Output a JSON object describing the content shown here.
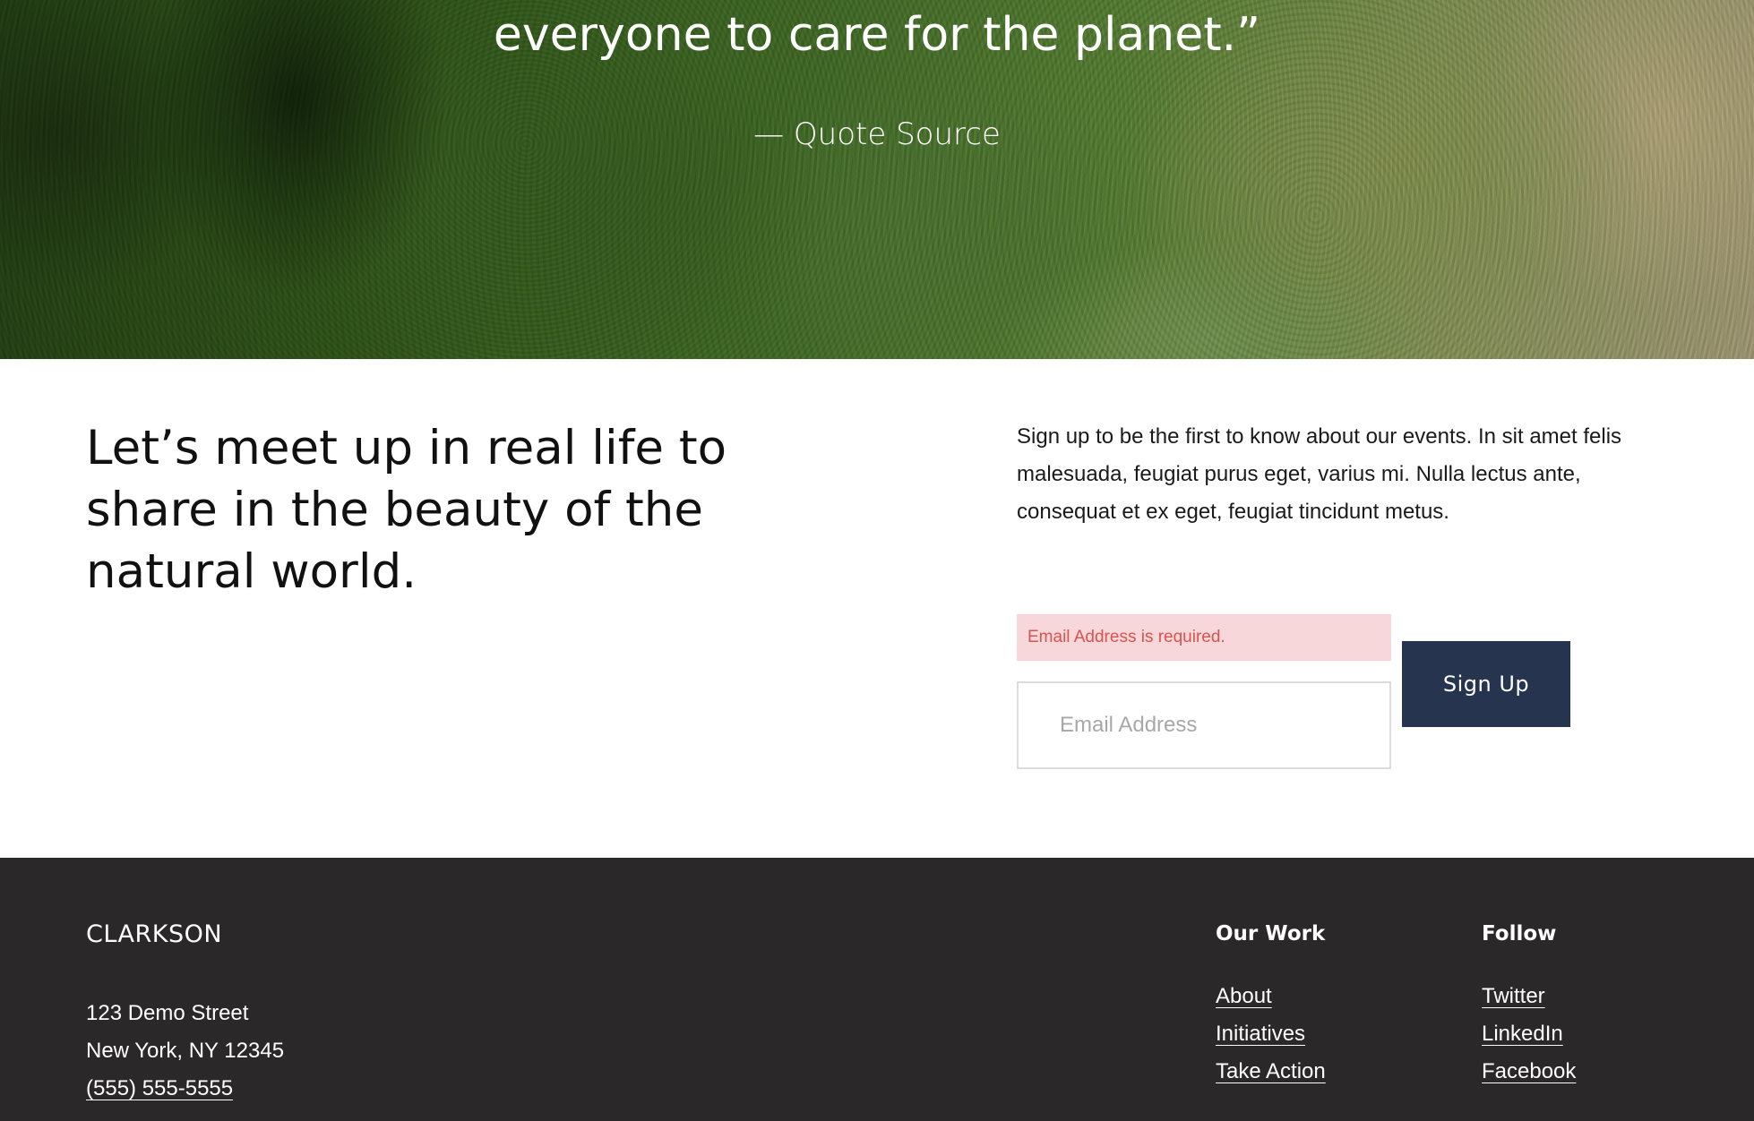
{
  "hero": {
    "quote_line": "everyone to care for the planet.”",
    "source": "— Quote Source"
  },
  "signup": {
    "heading": "Let’s meet up in real life to share in the beauty of the natural world.",
    "description": "Sign up to be the first to know about our events. In sit amet felis malesuada, feugiat purus eget, varius mi. Nulla lectus ante, consequat et ex eget, feugiat tincidunt metus.",
    "error_message": "Email Address is required.",
    "email_placeholder": "Email Address",
    "email_value": "",
    "button_label": "Sign Up"
  },
  "footer": {
    "brand": "CLARKSON",
    "address_line1": "123 Demo Street",
    "address_line2": "New York, NY 12345",
    "phone": "(555) 555-5555",
    "columns": [
      {
        "title": "Our Work",
        "links": [
          "About",
          "Initiatives",
          "Take Action"
        ]
      },
      {
        "title": "Follow",
        "links": [
          "Twitter",
          "LinkedIn",
          "Facebook"
        ]
      }
    ]
  },
  "colors": {
    "button_bg": "#27344f",
    "error_bg": "#f8d7da",
    "error_text": "#d9534f",
    "footer_bg": "#2a2829"
  }
}
